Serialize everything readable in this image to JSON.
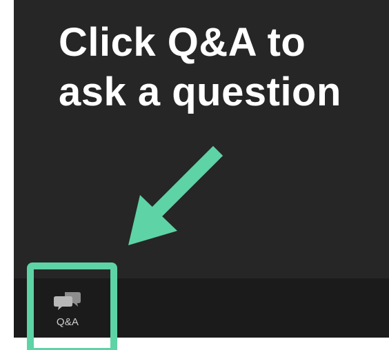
{
  "instruction": {
    "line1": "Click Q&A to",
    "line2": "ask a question"
  },
  "toolbar": {
    "qa_button": {
      "label": "Q&A",
      "icon": "chat-bubbles-icon"
    }
  },
  "colors": {
    "background": "#262626",
    "toolbar": "#1b1b1b",
    "accent": "#5ed3a6",
    "text": "#ffffff",
    "label": "#cfcfcf"
  }
}
